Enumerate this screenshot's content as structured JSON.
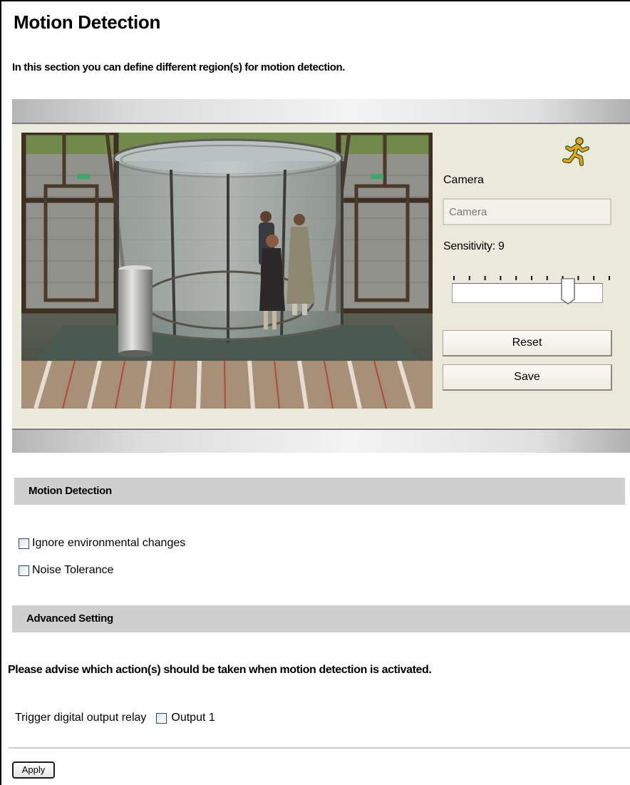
{
  "page": {
    "title": "Motion Detection",
    "intro": "In this section you can define different region(s) for motion detection."
  },
  "camera_panel": {
    "camera_label": "Camera",
    "camera_placeholder": "Camera",
    "sensitivity_label": "Sensitivity: 9",
    "sensitivity_value": 9,
    "sensitivity_max": 10,
    "reset_label": "Reset",
    "save_label": "Save",
    "motion_icon": "running-man-icon"
  },
  "motion_section": {
    "header": "Motion Detection",
    "options": [
      {
        "label": "Ignore environmental changes",
        "checked": false
      },
      {
        "label": "Noise Tolerance",
        "checked": false
      }
    ]
  },
  "advanced_section": {
    "header": "Advanced Setting",
    "advise": "Please advise which action(s) should be taken when motion detection is activated.",
    "trigger_label": "Trigger digital output relay",
    "output_label": "Output 1",
    "output_checked": false
  },
  "apply_label": "Apply",
  "colors": {
    "panel_bg": "#ebe8dc",
    "section_header_bg": "#cfcfcf",
    "checkbox_border": "#2c4a76"
  }
}
